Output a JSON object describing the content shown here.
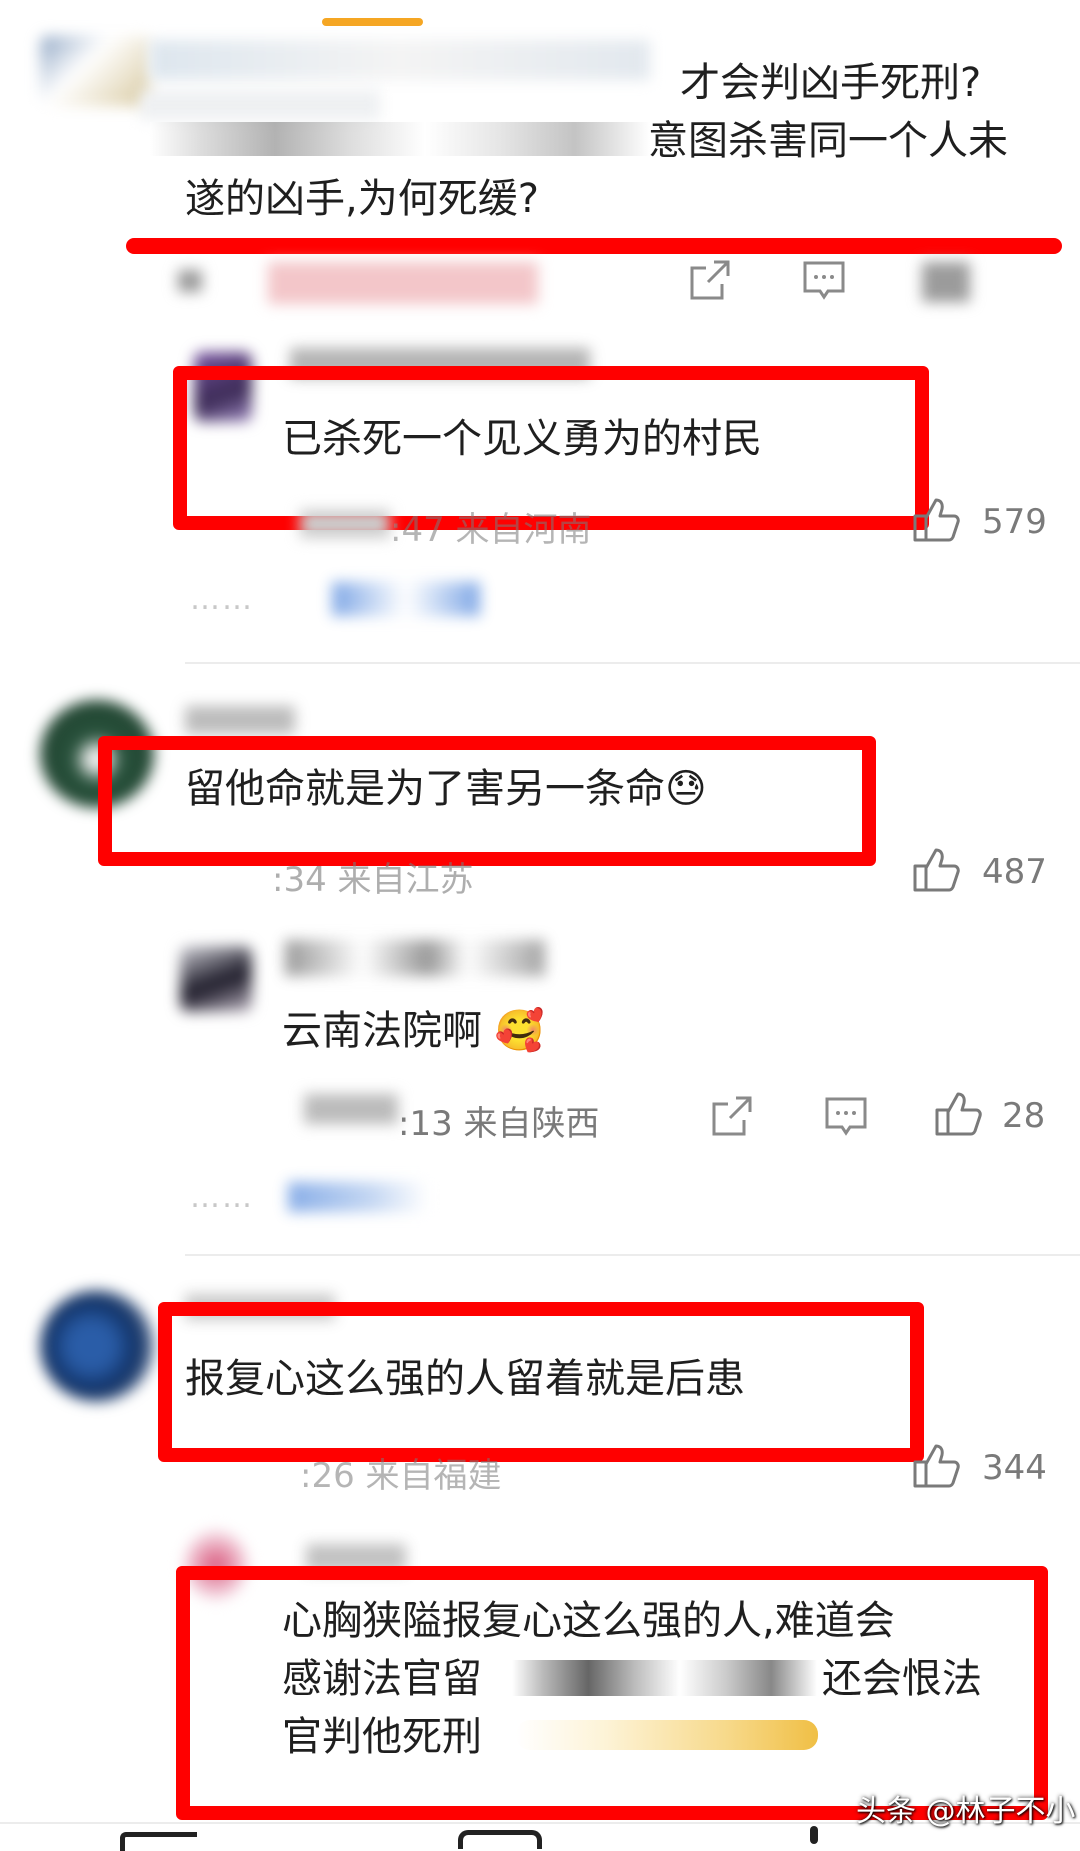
{
  "comments": [
    {
      "text_line1": "才会判凶手死刑?",
      "text_line2": "意图杀害同一个人未",
      "text_line3": "遂的凶手,为何死缓?"
    },
    {
      "text": "已杀死一个见义勇为的村民",
      "meta": ":47 来自河南",
      "likes": "579"
    },
    {
      "text": "留他命就是为了害另一条命",
      "emoji": "😓",
      "meta": ":34 来自江苏",
      "likes": "487"
    },
    {
      "text": "云南法院啊",
      "emoji": "🥰",
      "meta": ":13 来自陕西",
      "likes": "28"
    },
    {
      "text": "报复心这么强的人留着就是后患",
      "meta": ":26 来自福建",
      "likes": "344"
    },
    {
      "text_line1": "心胸狭隘报复心这么强的人,难道会",
      "text_line2a": "感谢法官留",
      "text_line2b": "还会恨法",
      "text_line3": "官判他死刑"
    }
  ],
  "reply_more_dots": "……",
  "watermark": "头条 @林子不小",
  "icons": [
    "share-icon",
    "comment-icon",
    "like-icon"
  ],
  "colors": {
    "accent": "#f5a623",
    "highlight": "#ff0000",
    "meta": "#7a7a7a"
  }
}
